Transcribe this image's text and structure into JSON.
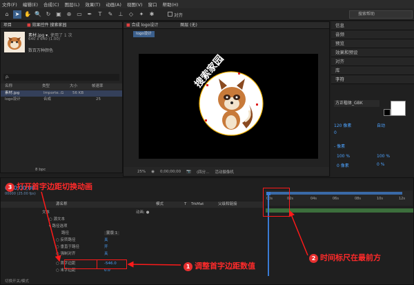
{
  "menu": [
    "文件(F)",
    "编辑(E)",
    "合成(C)",
    "图层(L)",
    "效果(T)",
    "动画(A)",
    "视图(V)",
    "窗口",
    "帮助(H)"
  ],
  "toolbar": {
    "align_label": "对齐",
    "search_placeholder": "搜索帮助"
  },
  "project": {
    "tab_label": "项目",
    "effects_tab": "效果控件 搜索家园",
    "item_name": "素材.jpg ▾",
    "item_used": ", 使用了 1 次",
    "item_dims": "640 x 640 (1.00)",
    "item_color": "数百万种颜色",
    "search_placeholder": "ρ.",
    "columns": [
      "名称",
      "类型",
      "大小",
      "帧速率"
    ],
    "rows": [
      {
        "name": "素材.jpg",
        "type": "Importe..G",
        "size": "56 KB",
        "fps": ""
      },
      {
        "name": "logo设计",
        "type": "合成",
        "size": "",
        "fps": "25"
      }
    ],
    "bpc": "8 bpc"
  },
  "comp": {
    "tab_label": "合成 logo设计",
    "layer_tab": "图层 (无)",
    "badge": "logo设计",
    "logo_text": "搜索家园",
    "zoom": "25%",
    "timecode": "0;00;00;00",
    "quality": "(四分...",
    "camera": "活动摄像机"
  },
  "right_panel": [
    "信息",
    "音频",
    "预览",
    "效果和预设",
    "对齐",
    "库"
  ],
  "character": {
    "title": "字符",
    "font": "方正楷体_GBK",
    "size": "120 像素",
    "leading": "自动",
    "tracking": "0",
    "tracking_label": "- 像素",
    "scale_v": "100 %",
    "scale_h": "100 %",
    "baseline": "0 像素",
    "tsume": "0 %"
  },
  "timeline": {
    "timecode": "0;00;00;00",
    "fps_note": "00000 (25.00 fps)",
    "col_name": "源名称",
    "col_mode": "模式",
    "col_t": "T",
    "col_trkmat": "TrkMat",
    "col_parent": "父级和链接",
    "rows": [
      {
        "label": "文本",
        "value": "动画: ●"
      },
      {
        "label": "○ 源文本",
        "value": ""
      },
      {
        "label": "▾ 路径选项",
        "value": ""
      },
      {
        "label": "路径",
        "value": "蒙版 1"
      },
      {
        "label": "○ 反转路径",
        "value": "关"
      },
      {
        "label": "○ 垂直于路径",
        "value": "开"
      },
      {
        "label": "○ 强制对齐",
        "value": "关"
      },
      {
        "label": "○ 首字边距",
        "value": "-546.0"
      },
      {
        "label": "○ 末字边距",
        "value": "0.0"
      }
    ],
    "ruler": [
      "00s",
      "02s",
      "04s",
      "06s",
      "08s",
      "10s",
      "12s"
    ],
    "bottom": "切换开关/模式"
  },
  "annotations": {
    "a1": "调整首字边距数值",
    "a2": "时间标尺在最前方",
    "a3": "打开首字边距切换动画",
    "n1": "1",
    "n2": "2",
    "n3": "3"
  },
  "colors": {
    "accent_red": "#ff1a1a",
    "highlight_blue": "#4da3ff"
  }
}
